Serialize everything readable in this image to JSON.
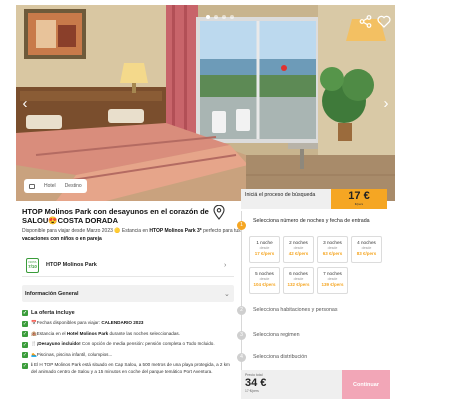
{
  "hero": {
    "tag_hotel": "Hotel",
    "tag_destination": "Destino",
    "prev_glyph": "‹",
    "next_glyph": "›",
    "share_icon": "share-icon",
    "favorite_icon": "heart-icon"
  },
  "hotel": {
    "title": "HTOP Molinos Park con desayunos en el corazón de SALOU😍COSTA DORADA",
    "subtitle_prefix": "Disponible para viajar desde Marzo 2023 🟡 Estancia en ",
    "subtitle_hotel": "HTOP Molinos Park 3*",
    "subtitle_mid": " perfecto para tus ",
    "subtitle_bold": "vacaciones con niños o en pareja",
    "card_name": "HTOP Molinos Park",
    "rating_label": "NOTA",
    "rating_value": "7/10"
  },
  "info": {
    "title": "Información General"
  },
  "offer": {
    "title": "La oferta incluye",
    "items": [
      {
        "pre": "📅Fechas disponibles para viajar: ",
        "bold": "CALENDARIO 2023",
        "post": ""
      },
      {
        "pre": "🏨Estancia en el ",
        "bold": "Hotel Molinos Park",
        "post": " durante las noches seleccionadas."
      },
      {
        "pre": "🍴",
        "bold": "¡Desayuno incluido!",
        "post": " Con opción de media pensión: pensión completa o Todo Incluido."
      },
      {
        "pre": "🏊Piscinas, piscina infantil, columpios...",
        "bold": "",
        "post": ""
      },
      {
        "pre": "ℹ El H TOP Molinos Park está situado en Cap Salou, a 500 metros de una playa protegida, a 2 km del animado centro de Salou y a 15 minutos en coche del parque temático Port Aventura.",
        "bold": "",
        "post": ""
      }
    ]
  },
  "booking": {
    "start_label": "Iniciá el proceso de búsqueda",
    "start_price": "17 €",
    "start_price_unit": "€/pers",
    "steps": [
      {
        "num": "1",
        "label": "Selecciona número de noches y fecha de entrada"
      },
      {
        "num": "2",
        "label": "Selecciona habitaciones y personas"
      },
      {
        "num": "3",
        "label": "Selecciona regimen"
      },
      {
        "num": "4",
        "label": "Selecciona distribución"
      }
    ],
    "nights": [
      {
        "label": "1 noche",
        "from": "desde",
        "price": "17 €/pers"
      },
      {
        "label": "2 noches",
        "from": "desde",
        "price": "42 €/pers"
      },
      {
        "label": "3 noches",
        "from": "desde",
        "price": "63 €/pers"
      },
      {
        "label": "4 noches",
        "from": "desde",
        "price": "83 €/pers"
      },
      {
        "label": "5 noches",
        "from": "desde",
        "price": "104 €/pers"
      },
      {
        "label": "6 noches",
        "from": "desde",
        "price": "132 €/pers"
      },
      {
        "label": "7 noches",
        "from": "desde",
        "price": "139 €/pers"
      }
    ],
    "total_label": "Precio total",
    "total_value": "34 €",
    "total_sub": "17 €/pers",
    "continue_label": "Continuar"
  },
  "colors": {
    "accent": "#f5a623",
    "continue_bg": "#f2a6b7",
    "check_green": "#3a9c3a"
  }
}
